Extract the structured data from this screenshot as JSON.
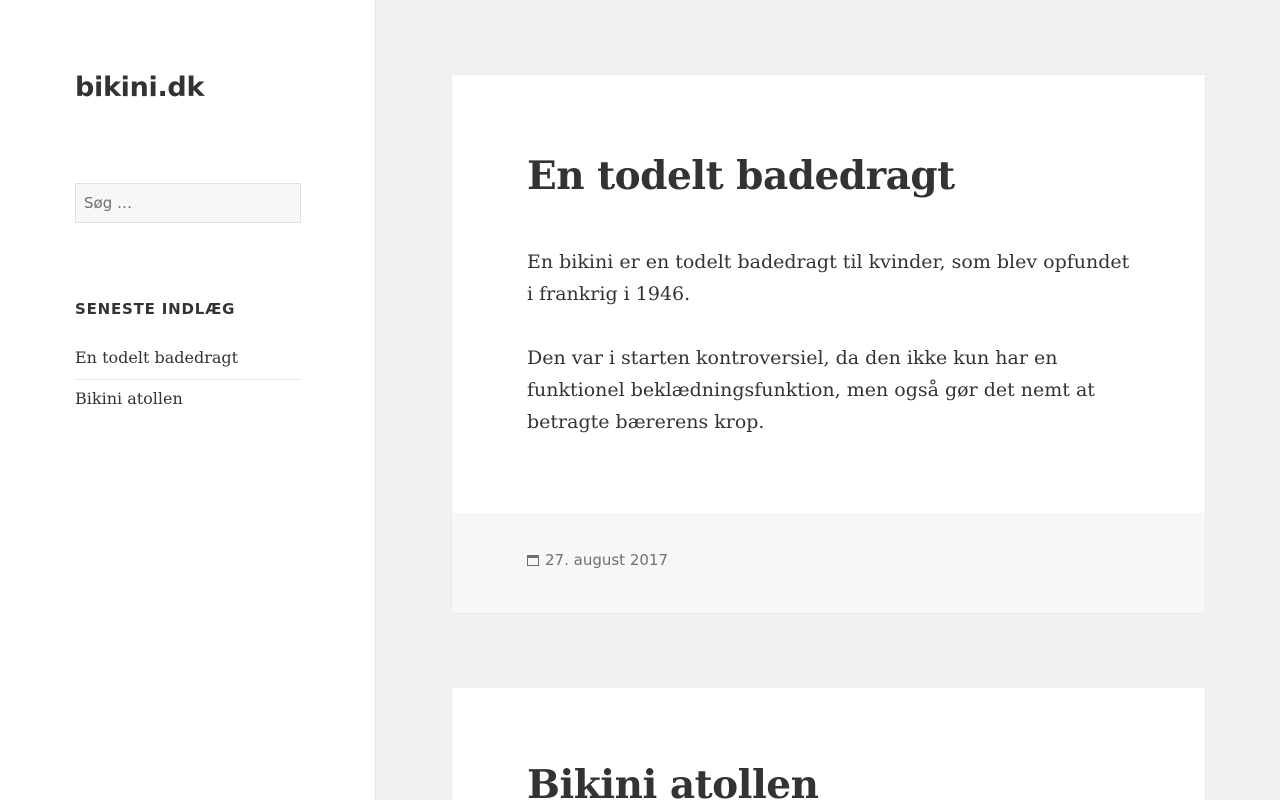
{
  "site": {
    "title": "bikini.dk"
  },
  "search": {
    "placeholder": "Søg …"
  },
  "recent_posts": {
    "title": "SENESTE INDLÆG",
    "items": [
      {
        "label": "En todelt badedragt"
      },
      {
        "label": "Bikini atollen"
      }
    ]
  },
  "posts": [
    {
      "title": "En todelt badedragt",
      "paragraphs": [
        "En bikini er en todelt badedragt til kvinder, som blev opfundet i frankrig i 1946.",
        "Den var i starten kontroversiel, da den ikke kun har en funktionel beklædningsfunktion, men også gør det nemt at betragte bærerens krop."
      ],
      "date": "27. august 2017"
    },
    {
      "title": "Bikini atollen"
    }
  ]
}
